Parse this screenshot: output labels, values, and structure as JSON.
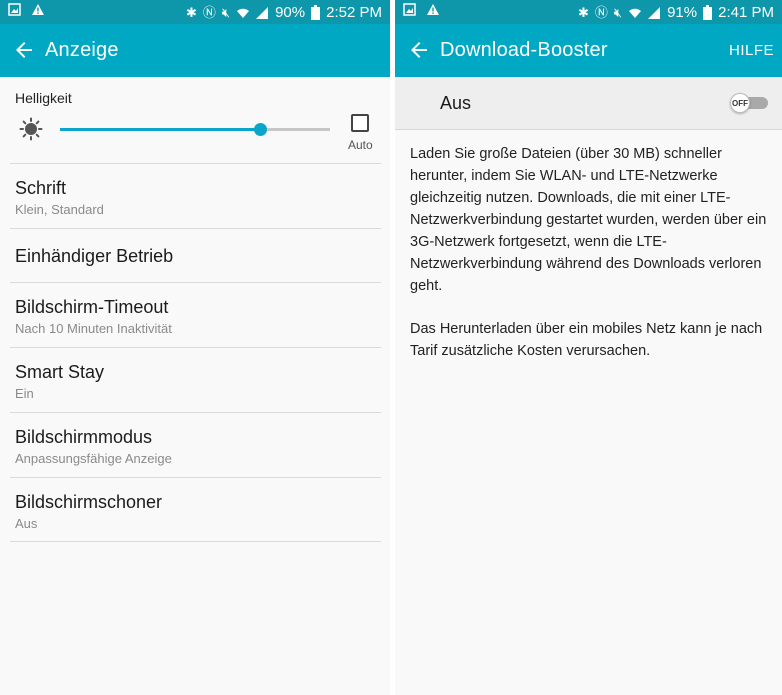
{
  "left": {
    "status_bar": {
      "battery": "90%",
      "time": "2:52 PM"
    },
    "app_bar": {
      "title": "Anzeige"
    },
    "brightness": {
      "label": "Helligkeit",
      "level_percent": 74,
      "auto_label": "Auto"
    },
    "items": [
      {
        "title": "Schrift",
        "subtitle": "Klein, Standard"
      },
      {
        "title": "Einhändiger Betrieb"
      },
      {
        "title": "Bildschirm-Timeout",
        "subtitle": "Nach 10 Minuten Inaktivität"
      },
      {
        "title": "Smart Stay",
        "subtitle": "Ein"
      },
      {
        "title": "Bildschirmmodus",
        "subtitle": "Anpassungsfähige Anzeige"
      },
      {
        "title": "Bildschirmschoner",
        "subtitle": "Aus"
      }
    ]
  },
  "right": {
    "status_bar": {
      "battery": "91%",
      "time": "2:41 PM"
    },
    "app_bar": {
      "title": "Download-Booster",
      "help": "HILFE"
    },
    "toggle": {
      "label": "Aus",
      "state": "OFF"
    },
    "paragraphs": [
      "Laden Sie große Dateien (über 30 MB) schneller herunter, indem Sie WLAN- und LTE-Netzwerke gleichzeitig nutzen. Downloads, die mit einer LTE-Netzwerkverbindung gestartet wurden, werden über ein 3G-Netzwerk fortgesetzt, wenn die LTE-Netzwerkverbindung während des Downloads verloren geht.",
      "Das Herunterladen über ein mobiles Netz kann je nach Tarif zusätzliche Kosten verursachen."
    ]
  },
  "colors": {
    "status_bar": "#0e96aa",
    "app_bar": "#00a8c4",
    "accent": "#0aa5c8"
  }
}
